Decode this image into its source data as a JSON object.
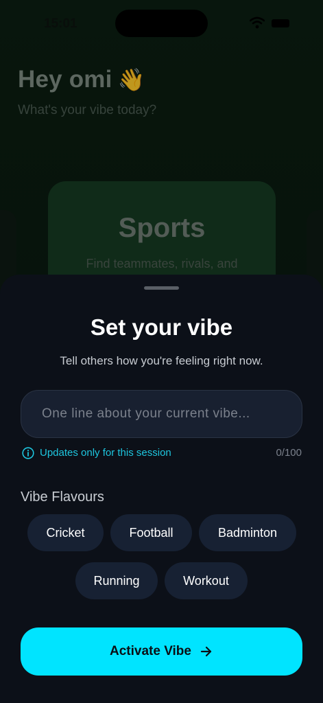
{
  "status_bar": {
    "time": "15:01"
  },
  "background": {
    "greeting": "Hey omi",
    "greeting_emoji": "👋",
    "subtitle": "What's your vibe today?",
    "card": {
      "title": "Sports",
      "description": "Find teammates, rivals, and"
    }
  },
  "sheet": {
    "title": "Set your vibe",
    "subtitle": "Tell others how you're feeling right now.",
    "input": {
      "placeholder": "One line about your current vibe...",
      "value": ""
    },
    "hint": "Updates only for this session",
    "char_count": "0/100",
    "flavours_label": "Vibe Flavours",
    "flavours": [
      "Cricket",
      "Football",
      "Badminton",
      "Running",
      "Workout"
    ],
    "activate_label": "Activate Vibe"
  },
  "colors": {
    "accent": "#00e4ff",
    "hint": "#1ec6df",
    "sheet_background": "#0c1018",
    "chip_background": "#172133"
  },
  "icons": [
    "wifi-icon",
    "battery-icon",
    "info-icon",
    "arrow-right-icon"
  ]
}
